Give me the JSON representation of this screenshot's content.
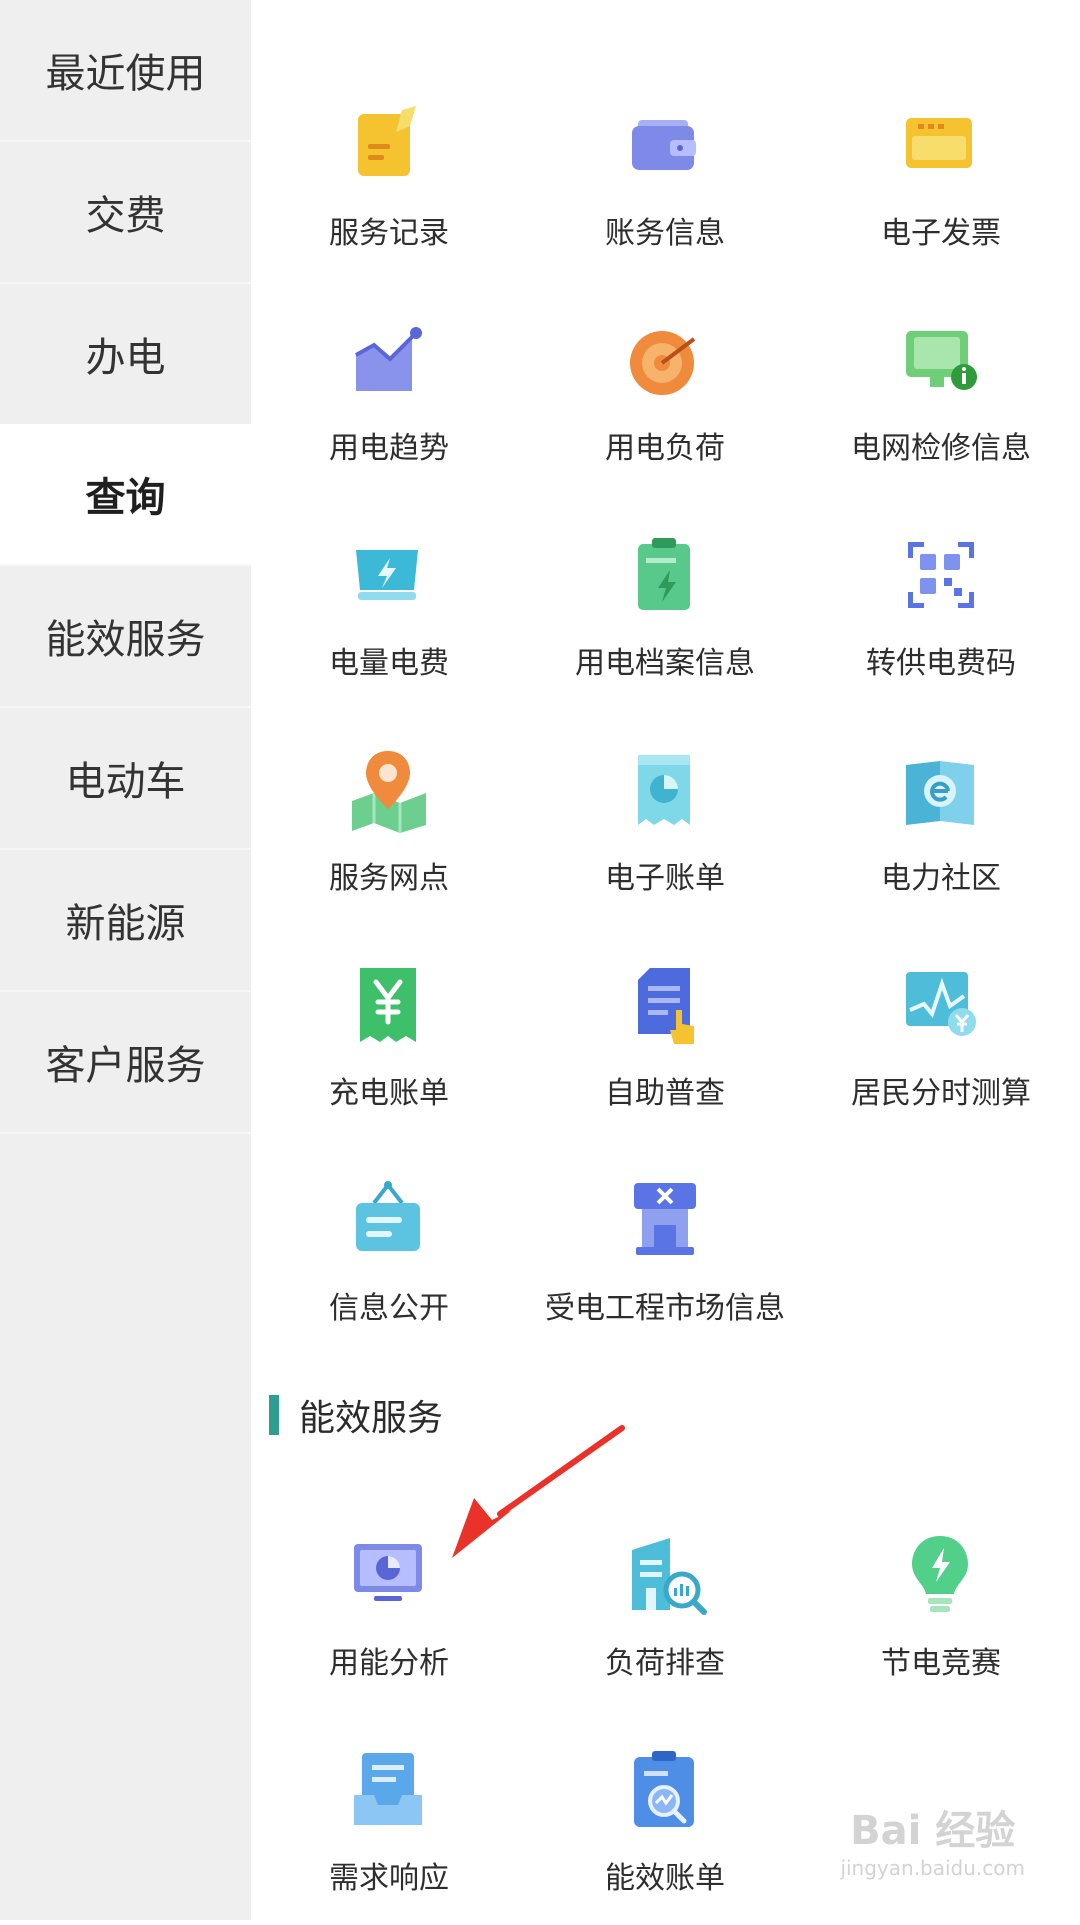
{
  "sidebar": {
    "items": [
      {
        "label": "最近使用",
        "active": false
      },
      {
        "label": "交费",
        "active": false
      },
      {
        "label": "办电",
        "active": false
      },
      {
        "label": "查询",
        "active": true
      },
      {
        "label": "能效服务",
        "active": false
      },
      {
        "label": "电动车",
        "active": false
      },
      {
        "label": "新能源",
        "active": false
      },
      {
        "label": "客户服务",
        "active": false
      }
    ]
  },
  "query": {
    "items": [
      {
        "label": "服务记录",
        "icon": "note-icon"
      },
      {
        "label": "账务信息",
        "icon": "wallet-icon"
      },
      {
        "label": "电子发票",
        "icon": "invoice-icon"
      },
      {
        "label": "用电趋势",
        "icon": "trend-chart-icon"
      },
      {
        "label": "用电负荷",
        "icon": "gauge-icon"
      },
      {
        "label": "电网检修信息",
        "icon": "monitor-plug-info-icon"
      },
      {
        "label": "电量电费",
        "icon": "bolt-screen-icon"
      },
      {
        "label": "用电档案信息",
        "icon": "clipboard-bolt-icon"
      },
      {
        "label": "转供电费码",
        "icon": "qr-code-icon"
      },
      {
        "label": "服务网点",
        "icon": "map-pin-icon"
      },
      {
        "label": "电子账单",
        "icon": "pie-receipt-icon"
      },
      {
        "label": "电力社区",
        "icon": "book-e-icon"
      },
      {
        "label": "充电账单",
        "icon": "yen-receipt-icon"
      },
      {
        "label": "自助普查",
        "icon": "document-hand-icon"
      },
      {
        "label": "居民分时测算",
        "icon": "chart-yen-icon"
      },
      {
        "label": "信息公开",
        "icon": "hanging-sign-icon"
      },
      {
        "label": "受电工程市场信息",
        "icon": "building-tools-icon"
      }
    ]
  },
  "energy_section": {
    "title": "能效服务",
    "items": [
      {
        "label": "用能分析",
        "icon": "monitor-pie-icon"
      },
      {
        "label": "负荷排查",
        "icon": "building-search-icon"
      },
      {
        "label": "节电竞赛",
        "icon": "bulb-bolt-icon"
      },
      {
        "label": "需求响应",
        "icon": "inbox-tray-icon"
      },
      {
        "label": "能效账单",
        "icon": "clipboard-chart-search-icon"
      }
    ]
  },
  "watermark": {
    "main": "Bai 经验",
    "sub": "jingyan.baidu.com"
  },
  "colors": {
    "accent": "#2d9e8f",
    "sidebar_bg": "#efefef",
    "arrow": "#e8322a"
  }
}
